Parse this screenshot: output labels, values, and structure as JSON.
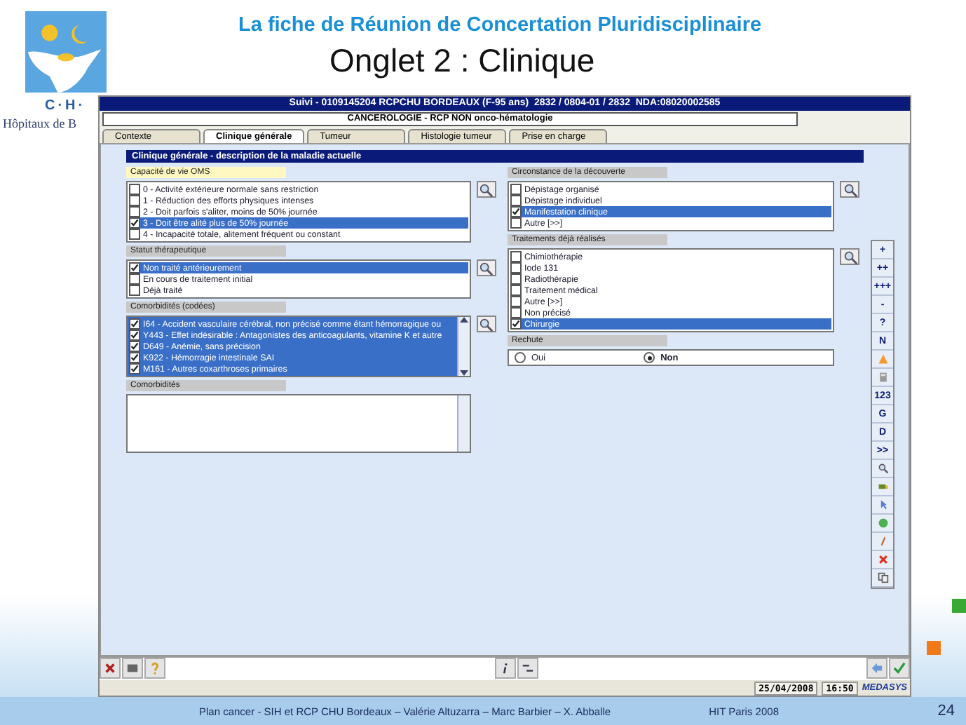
{
  "slide": {
    "title": "La fiche de Réunion de Concertation Pluridisciplinaire",
    "subtitle": "Onglet 2 : Clinique",
    "logo_text": "C·H·",
    "logo_caption": "Hôpitaux de B",
    "footer": "Plan cancer - SIH et RCP CHU Bordeaux – Valérie Altuzarra – Marc Barbier – X. Abballe",
    "event": "HIT Paris 2008",
    "page": "24"
  },
  "window": {
    "title": "Suivi - 0109145204 RCPCHU BORDEAUX (F-95 ans)  2832 / 0804-01 / 2832  NDA:08020002585",
    "context": "CANCEROLOGIE - RCP NON onco-hématologie"
  },
  "tabs": [
    {
      "label": "Contexte",
      "selected": false
    },
    {
      "label": "Clinique générale",
      "selected": true
    },
    {
      "label": "Tumeur",
      "selected": false
    },
    {
      "label": "Histologie tumeur",
      "selected": false
    },
    {
      "label": "Prise en charge",
      "selected": false
    }
  ],
  "panel_title": "Clinique générale - description de la maladie actuelle",
  "left_sections": [
    {
      "kind": "checklist",
      "label": "Capacité de vie OMS",
      "focused": true,
      "items": [
        {
          "text": "0 - Activité extérieure normale sans restriction",
          "checked": false,
          "selected": false
        },
        {
          "text": "1 - Réduction des efforts physiques intenses",
          "checked": false,
          "selected": false
        },
        {
          "text": "2 - Doit parfois s'aliter, moins de 50% journée",
          "checked": false,
          "selected": false
        },
        {
          "text": "3 - Doit être alité plus de 50% journée",
          "checked": true,
          "selected": true
        },
        {
          "text": "4 - Incapacité totale, alitement fréquent ou constant",
          "checked": false,
          "selected": false
        }
      ]
    },
    {
      "kind": "checklist",
      "label": "Statut thérapeutique",
      "focused": false,
      "items": [
        {
          "text": "Non traité antérieurement",
          "checked": true,
          "selected": true
        },
        {
          "text": "En cours de traitement initial",
          "checked": false,
          "selected": false
        },
        {
          "text": "Déjà traité",
          "checked": false,
          "selected": false
        }
      ]
    },
    {
      "kind": "scrolllist",
      "label": "Comorbidités (codées)",
      "focused": false,
      "items": [
        {
          "text": "I64 - Accident vasculaire cérébral, non précisé comme étant hémorragique ou",
          "checked": true,
          "selected": true
        },
        {
          "text": "Y443 - Effet indésirable : Antagonistes des anticoagulants, vitamine K et autre",
          "checked": true,
          "selected": true
        },
        {
          "text": "D649 - Anémie, sans précision",
          "checked": true,
          "selected": true
        },
        {
          "text": "K922 - Hémorragie intestinale SAI",
          "checked": true,
          "selected": true
        },
        {
          "text": "M161 - Autres coxarthroses primaires",
          "checked": true,
          "selected": true
        }
      ]
    },
    {
      "kind": "textarea",
      "label": "Comorbidités",
      "focused": false
    }
  ],
  "right_sections": [
    {
      "kind": "checklist",
      "label": "Circonstance de la découverte",
      "focused": false,
      "items": [
        {
          "text": "Dépistage organisé",
          "checked": false,
          "selected": false
        },
        {
          "text": "Dépistage individuel",
          "checked": false,
          "selected": false
        },
        {
          "text": "Manifestation clinique",
          "checked": true,
          "selected": true
        },
        {
          "text": "Autre [>>]",
          "checked": false,
          "selected": false
        }
      ]
    },
    {
      "kind": "checklist",
      "label": "Traitements déjà réalisés",
      "focused": false,
      "items": [
        {
          "text": "Chimiothérapie",
          "checked": false,
          "selected": false
        },
        {
          "text": "Iode 131",
          "checked": false,
          "selected": false
        },
        {
          "text": "Radiothérapie",
          "checked": false,
          "selected": false
        },
        {
          "text": "Traitement médical",
          "checked": false,
          "selected": false
        },
        {
          "text": "Autre [>>]",
          "checked": false,
          "selected": false
        },
        {
          "text": "Non précisé",
          "checked": false,
          "selected": false
        },
        {
          "text": "Chirurgie",
          "checked": true,
          "selected": true
        }
      ]
    },
    {
      "kind": "radio",
      "label": "Rechute",
      "focused": false,
      "options": [
        {
          "text": "Oui",
          "selected": false
        },
        {
          "text": "Non",
          "selected": true
        }
      ]
    }
  ],
  "toolbar": [
    {
      "kind": "text",
      "label": "+"
    },
    {
      "kind": "text",
      "label": "++"
    },
    {
      "kind": "text",
      "label": "+++"
    },
    {
      "kind": "text",
      "label": "-"
    },
    {
      "kind": "text",
      "label": "?"
    },
    {
      "kind": "text",
      "label": "N"
    },
    {
      "kind": "icon"
    },
    {
      "kind": "icon"
    },
    {
      "kind": "text",
      "label": "123"
    },
    {
      "kind": "text",
      "label": "G"
    },
    {
      "kind": "text",
      "label": "D"
    },
    {
      "kind": "text",
      "label": ">>"
    },
    {
      "kind": "icon"
    },
    {
      "kind": "icon"
    },
    {
      "kind": "icon"
    },
    {
      "kind": "icon"
    },
    {
      "kind": "icon"
    },
    {
      "kind": "icon"
    },
    {
      "kind": "icon"
    }
  ],
  "status_bar": {
    "date": "25/04/2008",
    "time": "16:50",
    "brand": "MEDASYS"
  }
}
